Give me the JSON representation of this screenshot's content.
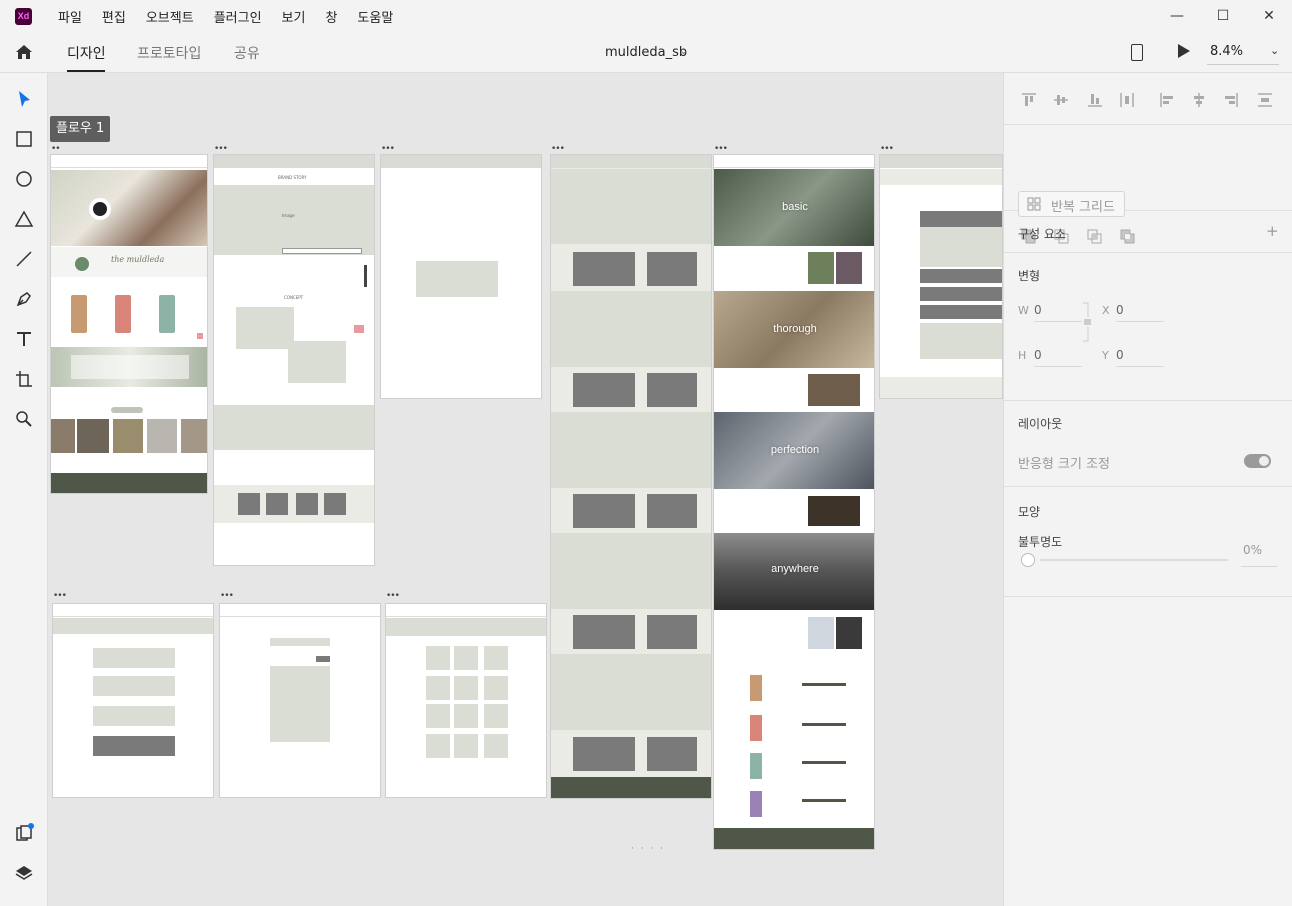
{
  "app": {
    "logo": "Xd",
    "accent": "#470137"
  },
  "menu": {
    "items": [
      "파일",
      "편집",
      "오브젝트",
      "플러그인",
      "보기",
      "창",
      "도움말"
    ]
  },
  "window_controls": {
    "minimize": "—",
    "maximize": "☐",
    "close": "✕"
  },
  "header": {
    "tabs": [
      {
        "label": "디자인",
        "active": true
      },
      {
        "label": "프로토타입",
        "active": false
      },
      {
        "label": "공유",
        "active": false
      }
    ],
    "doc_title": "muldleda_sb",
    "zoom": "8.4%"
  },
  "toolbar": {
    "tools": [
      "select-icon",
      "rectangle-icon",
      "ellipse-icon",
      "triangle-icon",
      "line-icon",
      "pen-icon",
      "text-icon",
      "artboard-icon",
      "zoom-icon"
    ],
    "bottom": [
      "plugins-icon",
      "layers-icon"
    ]
  },
  "canvas": {
    "flow_label": "플로우 1",
    "artboards": {
      "home": {
        "hero_brand": "the muldleda"
      },
      "story": {
        "title": "BRAND STORY",
        "caption_image": "Image",
        "concept": "CONCEPT"
      },
      "showcase": {
        "labels": [
          "basic",
          "thorough",
          "perfection",
          "anywhere"
        ]
      }
    },
    "status": "· · · ·"
  },
  "panel": {
    "repeat_grid": "반복 그리드",
    "components": "구성 요소",
    "components_add": "+",
    "transform": "변형",
    "w_label": "W",
    "w_value": "0",
    "x_label": "X",
    "x_value": "0",
    "h_label": "H",
    "h_value": "0",
    "y_label": "Y",
    "y_value": "0",
    "layout": "레이아웃",
    "responsive": "반응형 크기 조정",
    "appearance": "모양",
    "opacity_label": "불투명도",
    "opacity_value": "0%",
    "opacity_fraction": 0
  }
}
